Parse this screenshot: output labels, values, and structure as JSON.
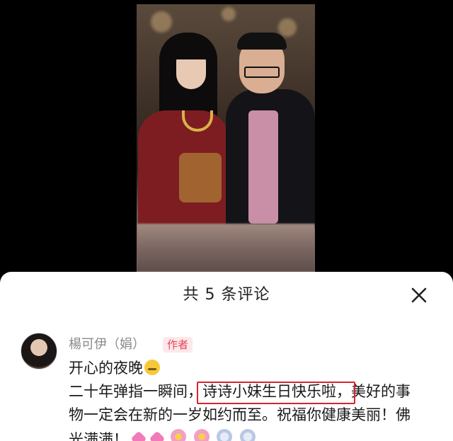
{
  "comments_panel": {
    "title": "共 5 条评论",
    "close_icon": "close-icon"
  },
  "comment": {
    "username": "楊可伊（娟）",
    "author_tag": "作者",
    "line1": "开心的夜晚",
    "line2_pre": "二十年弹指一瞬间，",
    "line2_highlight": "诗诗小妹生日快乐啦，",
    "line2_post": "美好的事",
    "line3": "物一定会在新的一岁如约而至。祝福你健康美丽！佛",
    "line4": "光满满！",
    "emojis": [
      "sleepy-face-icon",
      "heart-icon",
      "heart-icon",
      "flower-icon",
      "flower-icon",
      "sparkle-icon",
      "sparkle-icon"
    ],
    "highlight_color": "#d6242e"
  }
}
